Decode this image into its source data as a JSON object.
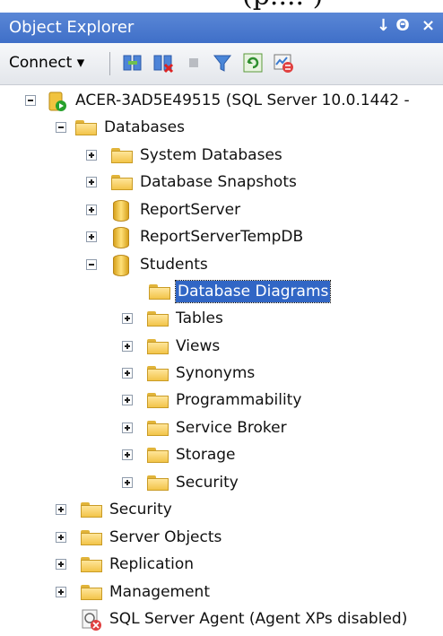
{
  "top_clip_text": "(p.... )",
  "window": {
    "title": "Object Explorer",
    "pin_label": "↓ Θ",
    "close_label": "×"
  },
  "toolbar": {
    "connect_label": "Connect",
    "icons": [
      "connect-object-explorer-icon",
      "disconnect-icon",
      "stop-icon",
      "filter-icon",
      "refresh-icon",
      "activity-monitor-icon"
    ]
  },
  "tree": {
    "server": "ACER-3AD5E49515 (SQL Server 10.0.1442 -",
    "databases": "Databases",
    "system_databases": "System Databases",
    "database_snapshots": "Database Snapshots",
    "report_server": "ReportServer",
    "report_server_temp": "ReportServerTempDB",
    "students": "Students",
    "database_diagrams": "Database Diagrams",
    "tables": "Tables",
    "views": "Views",
    "synonyms": "Synonyms",
    "programmability": "Programmability",
    "service_broker": "Service Broker",
    "storage": "Storage",
    "db_security": "Security",
    "security": "Security",
    "server_objects": "Server Objects",
    "replication": "Replication",
    "management": "Management",
    "sql_agent": "SQL Server Agent (Agent XPs disabled)"
  },
  "colors": {
    "titlebar": "#4a7bd0",
    "selection": "#3166c5",
    "folder": "#f2c449"
  }
}
